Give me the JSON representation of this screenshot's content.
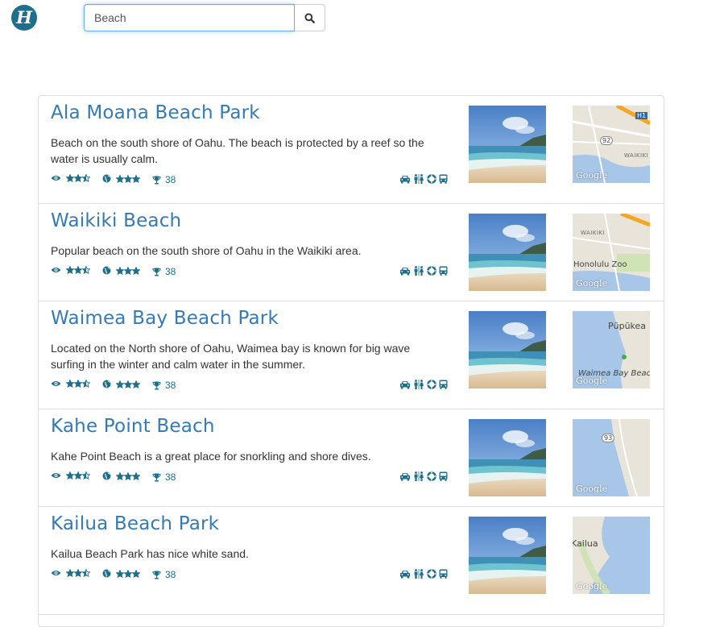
{
  "header": {
    "logo_letter": "H",
    "search": {
      "value": "Beach",
      "placeholder": ""
    },
    "search_button_icon": "search-icon"
  },
  "colors": {
    "link": "#337ab7",
    "icon": "#1f6e8c",
    "focus_border": "#66afe9"
  },
  "results": [
    {
      "title": "Ala Moana Beach Park",
      "description": "Beach on the south shore of Oahu. The beach is protected by a reef so the water is usually calm.",
      "views_rating": 2.5,
      "global_rating": 3,
      "trophies": "38",
      "amenities": [
        "car-icon",
        "restroom-icon",
        "lifeguard-icon",
        "bus-icon"
      ],
      "map_labels": [
        "92",
        "H1",
        "WAIKIKI",
        "Google"
      ]
    },
    {
      "title": "Waikiki Beach",
      "description": "Popular beach on the south shore of Oahu in the Waikiki area.",
      "views_rating": 2.5,
      "global_rating": 3,
      "trophies": "38",
      "amenities": [
        "car-icon",
        "restroom-icon",
        "lifeguard-icon",
        "bus-icon"
      ],
      "map_labels": [
        "WAIKIKI",
        "Honolulu Zoo",
        "Google"
      ]
    },
    {
      "title": "Waimea Bay Beach Park",
      "description": "Located on the North shore of Oahu, Waimea bay is known for big wave surfing in the winter and calm water in the summer.",
      "views_rating": 2.5,
      "global_rating": 3,
      "trophies": "38",
      "amenities": [
        "car-icon",
        "restroom-icon",
        "lifeguard-icon",
        "bus-icon"
      ],
      "map_labels": [
        "Pūpūkea",
        "Waimea Bay Beach",
        "Google"
      ]
    },
    {
      "title": "Kahe Point Beach",
      "description": "Kahe Point Beach is a great place for snorkling and shore dives.",
      "views_rating": 2.5,
      "global_rating": 3,
      "trophies": "38",
      "amenities": [
        "car-icon",
        "restroom-icon",
        "lifeguard-icon",
        "bus-icon"
      ],
      "map_labels": [
        "93",
        "Google"
      ]
    },
    {
      "title": "Kailua Beach Park",
      "description": "Kailua Beach Park has nice white sand.",
      "views_rating": 2.5,
      "global_rating": 3,
      "trophies": "38",
      "amenities": [
        "car-icon",
        "restroom-icon",
        "lifeguard-icon",
        "bus-icon"
      ],
      "map_labels": [
        "Kailua",
        "Google"
      ]
    }
  ]
}
